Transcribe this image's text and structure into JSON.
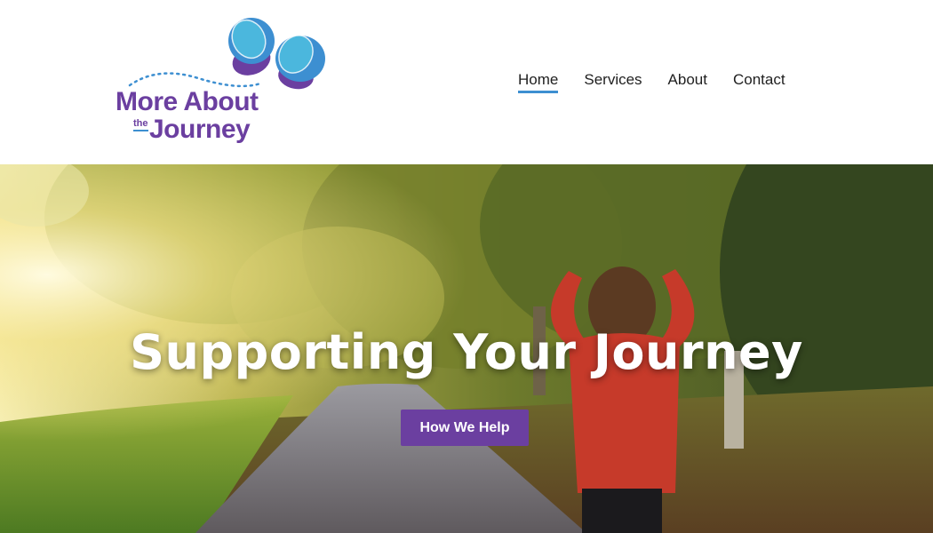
{
  "brand": {
    "name_line1": "More About",
    "name_small": "the",
    "name_line2": "Journey",
    "colors": {
      "purple": "#6b3fa0",
      "blue": "#3d8fd1",
      "teal": "#4fc0e0"
    },
    "logo_icon": "butterfly-icon"
  },
  "nav": {
    "items": [
      {
        "label": "Home",
        "active": true
      },
      {
        "label": "Services",
        "active": false
      },
      {
        "label": "About",
        "active": false
      },
      {
        "label": "Contact",
        "active": false
      }
    ],
    "active_underline_color": "#3d8fd1"
  },
  "hero": {
    "title": "Supporting Your Journey",
    "button_label": "How We Help",
    "button_color": "#6b3fa0",
    "image": "woman-walking-on-tree-lined-path-photo"
  }
}
